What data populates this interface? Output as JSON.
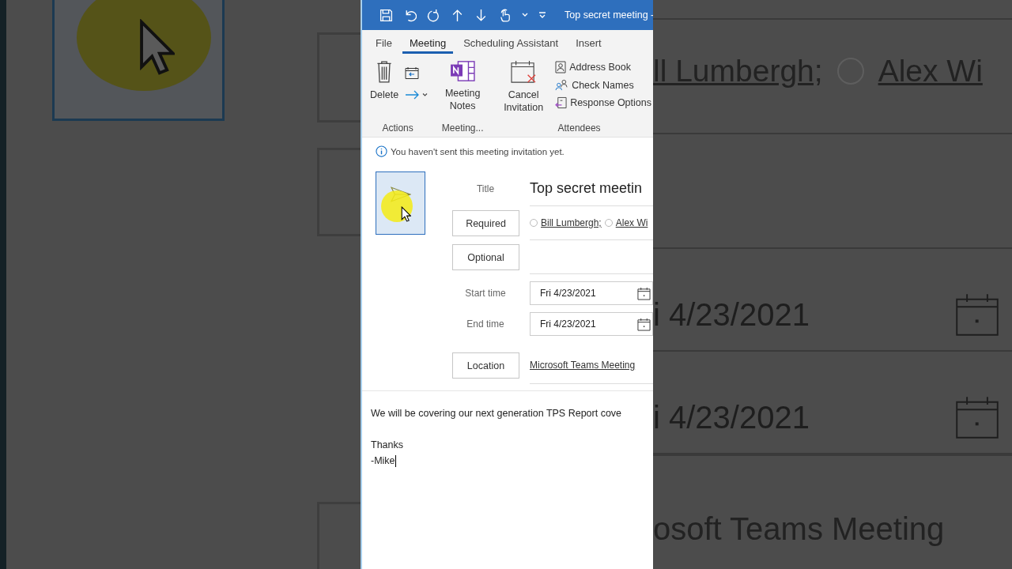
{
  "title_bar": {
    "title": "Top secret meeting -"
  },
  "tabs": [
    {
      "label": "File",
      "selected": false
    },
    {
      "label": "Meeting",
      "selected": true
    },
    {
      "label": "Scheduling Assistant",
      "selected": false
    },
    {
      "label": "Insert",
      "selected": false
    }
  ],
  "ribbon": {
    "actions": {
      "label": "Actions",
      "delete": "Delete"
    },
    "notes": {
      "label": "Meeting...",
      "button": "Meeting Notes"
    },
    "attendees": {
      "label": "Attendees",
      "cancel": "Cancel Invitation",
      "commands": [
        "Address Book",
        "Check Names",
        "Response Options"
      ]
    }
  },
  "info_bar": {
    "message": "You haven't sent this meeting invitation yet."
  },
  "form": {
    "title_label": "Title",
    "title_value": "Top secret meetin",
    "required_button": "Required",
    "attendees": [
      "Bill Lumbergh;",
      "Alex Wi"
    ],
    "optional_button": "Optional",
    "start_label": "Start time",
    "start_date": "Fri 4/23/2021",
    "end_label": "End time",
    "end_date": "Fri 4/23/2021",
    "location_button": "Location",
    "location_value": "Microsoft Teams Meeting"
  },
  "body": {
    "paragraphs": [
      [
        "We will be covering our next generation TPS Report cove"
      ],
      [
        "Thanks",
        "-Mike"
      ]
    ]
  },
  "backdrop": {
    "attendees": [
      "ll Lumbergh;",
      "Alex Wi"
    ],
    "dates": [
      "i 4/23/2021",
      "i 4/23/2021"
    ],
    "location": "osoft Teams Meeting"
  }
}
